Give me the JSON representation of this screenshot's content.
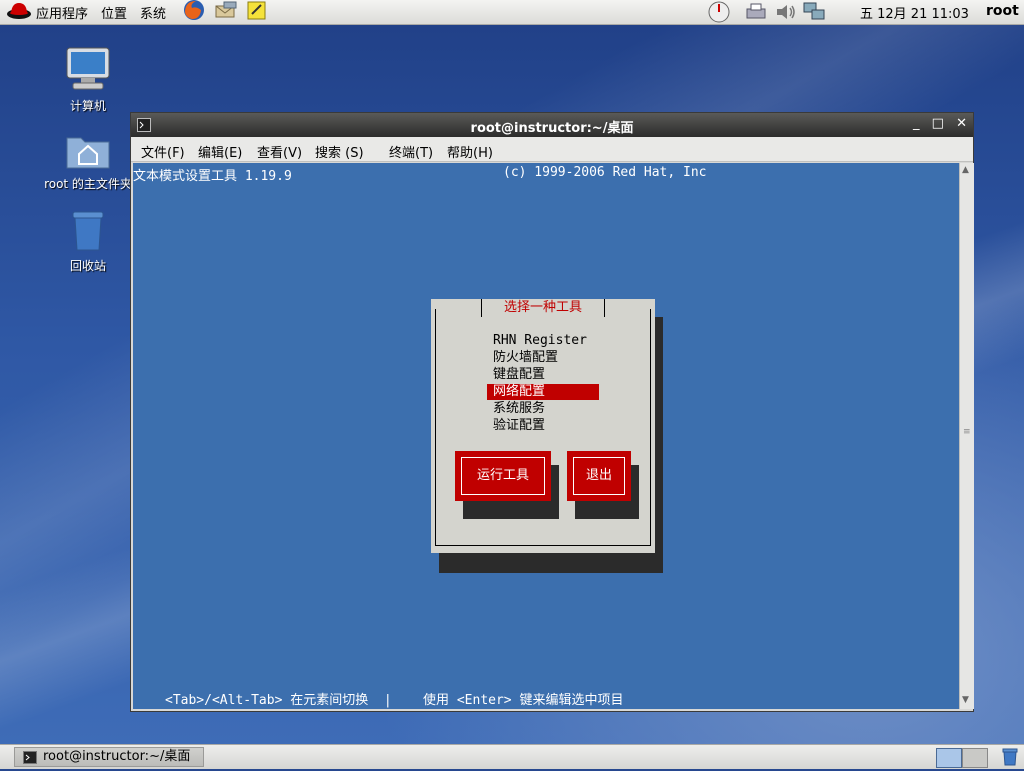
{
  "top_panel": {
    "menus": [
      "应用程序",
      "位置",
      "系统"
    ],
    "clock": "五 12月 21 11:03",
    "user": "root"
  },
  "desktop_icons": [
    {
      "label": "计算机",
      "icon": "computer-icon"
    },
    {
      "label": "root 的主文件夹",
      "icon": "home-folder-icon"
    },
    {
      "label": "回收站",
      "icon": "trash-icon"
    }
  ],
  "window": {
    "title": "root@instructor:~/桌面",
    "menus": [
      "文件(F)",
      "编辑(E)",
      "查看(V)",
      "搜索 (S)",
      "终端(T)",
      "帮助(H)"
    ]
  },
  "terminal": {
    "app_name": "文本模式设置工具 1.19.9",
    "copyright": "(c) 1999-2006 Red Hat, Inc",
    "dialog_title": "选择一种工具",
    "items": [
      "RHN Register",
      "防火墙配置",
      "键盘配置",
      "网络配置",
      "系统服务",
      "验证配置"
    ],
    "selected_index": 3,
    "run_button": "运行工具",
    "quit_button": "退出",
    "status_line": "<Tab>/<Alt-Tab> 在元素间切换  |    使用 <Enter> 键来编辑选中项目"
  },
  "bottom_panel": {
    "task": "root@instructor:~/桌面"
  },
  "colors": {
    "terminal_bg": "#3c6fae",
    "dialog_bg": "#d4d4ce",
    "accent_red": "#c00000"
  }
}
